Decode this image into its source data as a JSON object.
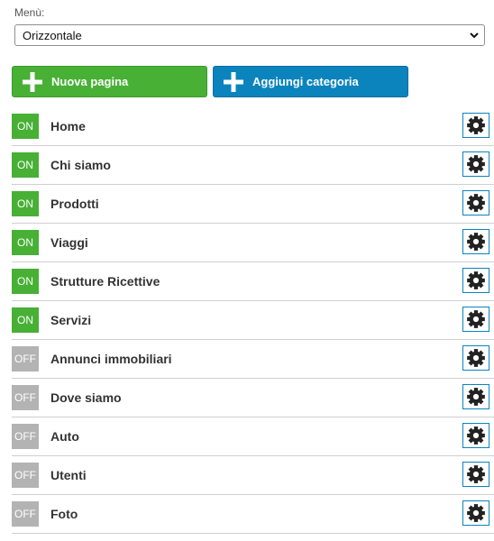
{
  "menu": {
    "label": "Menù:",
    "selected": "Orizzontale"
  },
  "actions": {
    "new_page": "Nuova pagina",
    "add_category": "Aggiungi categoria",
    "green": "#47b035",
    "blue": "#0b84bd"
  },
  "pages": [
    {
      "label": "Home",
      "status": "ON"
    },
    {
      "label": "Chi siamo",
      "status": "ON"
    },
    {
      "label": "Prodotti",
      "status": "ON"
    },
    {
      "label": "Viaggi",
      "status": "ON"
    },
    {
      "label": "Strutture Ricettive",
      "status": "ON"
    },
    {
      "label": "Servizi",
      "status": "ON"
    },
    {
      "label": "Annunci immobiliari",
      "status": "OFF"
    },
    {
      "label": "Dove siamo",
      "status": "OFF"
    },
    {
      "label": "Auto",
      "status": "OFF"
    },
    {
      "label": "Utenti",
      "status": "OFF"
    },
    {
      "label": "Foto",
      "status": "OFF"
    }
  ],
  "icons": {
    "plus": "plus-icon",
    "settings": "gear-icon",
    "dropdown": "chevron-down-icon"
  }
}
